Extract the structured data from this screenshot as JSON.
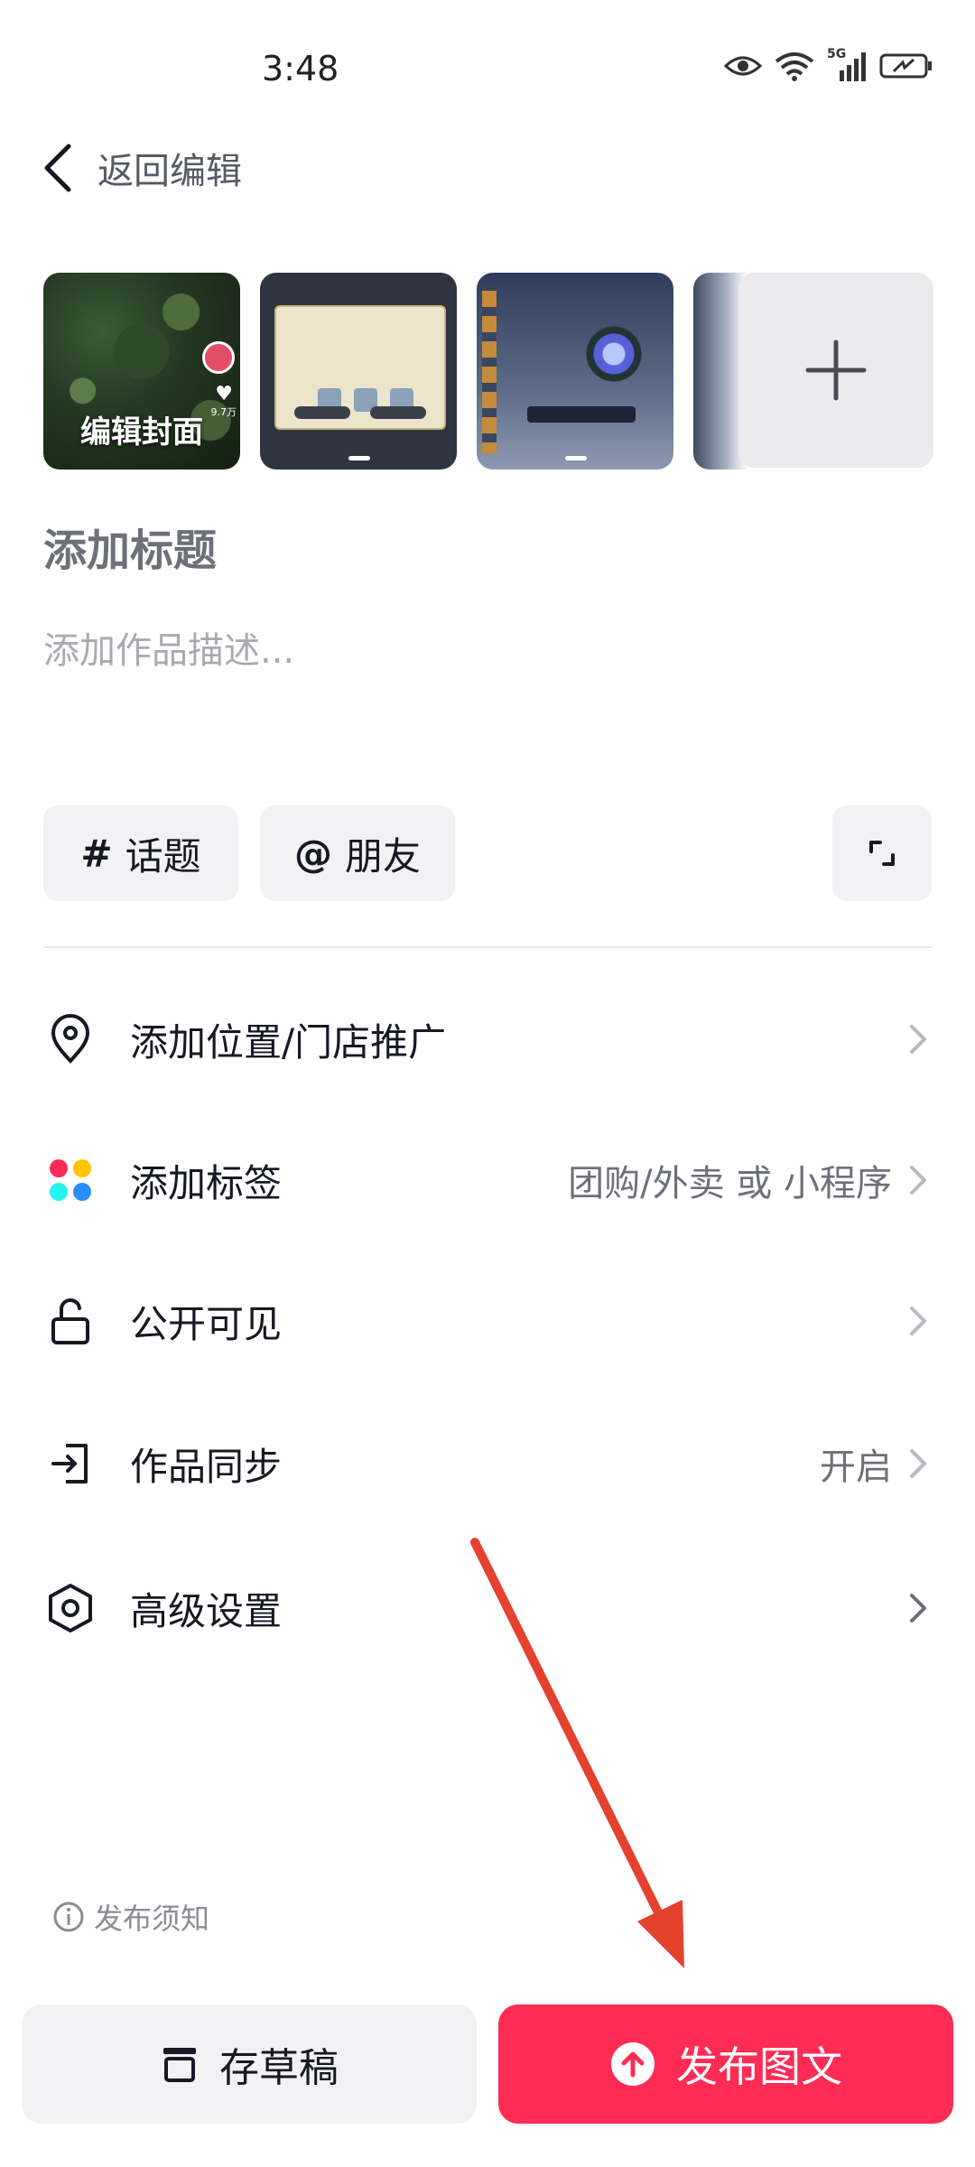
{
  "status_bar": {
    "time": "3:48",
    "network": "5G"
  },
  "nav": {
    "back_label": "返回编辑"
  },
  "media": {
    "cover_label": "编辑封面",
    "cover_likes": "9.7万"
  },
  "post": {
    "title_placeholder": "添加标题",
    "description_placeholder": "添加作品描述..."
  },
  "chips": {
    "topic_symbol": "#",
    "topic_label": "话题",
    "friend_symbol": "@",
    "friend_label": "朋友"
  },
  "settings": [
    {
      "label": "添加位置/门店推广",
      "value": "",
      "icon": "location-pin-icon"
    },
    {
      "label": "添加标签",
      "value": "团购/外卖 或 小程序",
      "icon": "colorful-dots-icon"
    },
    {
      "label": "公开可见",
      "value": "",
      "icon": "unlock-icon"
    },
    {
      "label": "作品同步",
      "value": "开启",
      "icon": "sync-icon"
    },
    {
      "label": "高级设置",
      "value": "",
      "icon": "gear-hex-icon"
    }
  ],
  "footer": {
    "notice": "发布须知",
    "draft_label": "存草稿",
    "publish_label": "发布图文"
  },
  "colors": {
    "accent": "#fe2c55",
    "annotation_arrow": "#e5412f"
  }
}
